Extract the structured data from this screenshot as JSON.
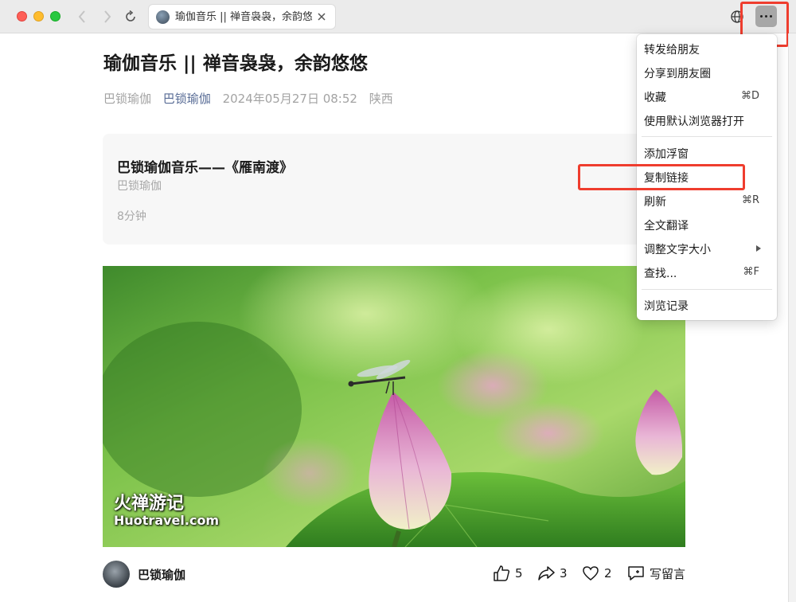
{
  "window": {
    "tab_title": "瑜伽音乐 || 禅音袅袅，余韵悠悠"
  },
  "article": {
    "title": "瑜伽音乐 || 禅音袅袅，余韵悠悠",
    "meta": {
      "author": "巴锁瑜伽",
      "account": "巴锁瑜伽",
      "datetime": "2024年05月27日 08:52",
      "location": "陕西"
    },
    "audio_card": {
      "title": "巴锁瑜伽音乐——《雁南渡》",
      "artist": "巴锁瑜伽",
      "duration": "8分钟"
    },
    "image": {
      "watermark_cn": "火禅游记",
      "watermark_en": "Huotravel.com"
    }
  },
  "footer": {
    "author": "巴锁瑜伽",
    "likes": "5",
    "shares": "3",
    "favorites": "2",
    "comment_label": "写留言"
  },
  "menu": {
    "items": [
      {
        "label": "转发给朋友",
        "shortcut": ""
      },
      {
        "label": "分享到朋友圈",
        "shortcut": ""
      },
      {
        "label": "收藏",
        "shortcut": "⌘D"
      },
      {
        "label": "使用默认浏览器打开",
        "shortcut": ""
      },
      {
        "label": "添加浮窗",
        "shortcut": ""
      },
      {
        "label": "复制链接",
        "shortcut": ""
      },
      {
        "label": "刷新",
        "shortcut": "⌘R"
      },
      {
        "label": "全文翻译",
        "shortcut": ""
      },
      {
        "label": "调整文字大小",
        "shortcut": ""
      },
      {
        "label": "查找...",
        "shortcut": "⌘F"
      },
      {
        "label": "浏览记录",
        "shortcut": ""
      }
    ]
  },
  "colors": {
    "highlight": "#ef3d2e",
    "link": "#576b95",
    "meta_gray": "#a3a3a3"
  },
  "icons": [
    "back-icon",
    "forward-icon",
    "reload-icon",
    "close-icon",
    "globe-icon",
    "more-icon",
    "like-icon",
    "share-icon",
    "heart-icon",
    "comment-icon",
    "submenu-arrow-icon"
  ]
}
